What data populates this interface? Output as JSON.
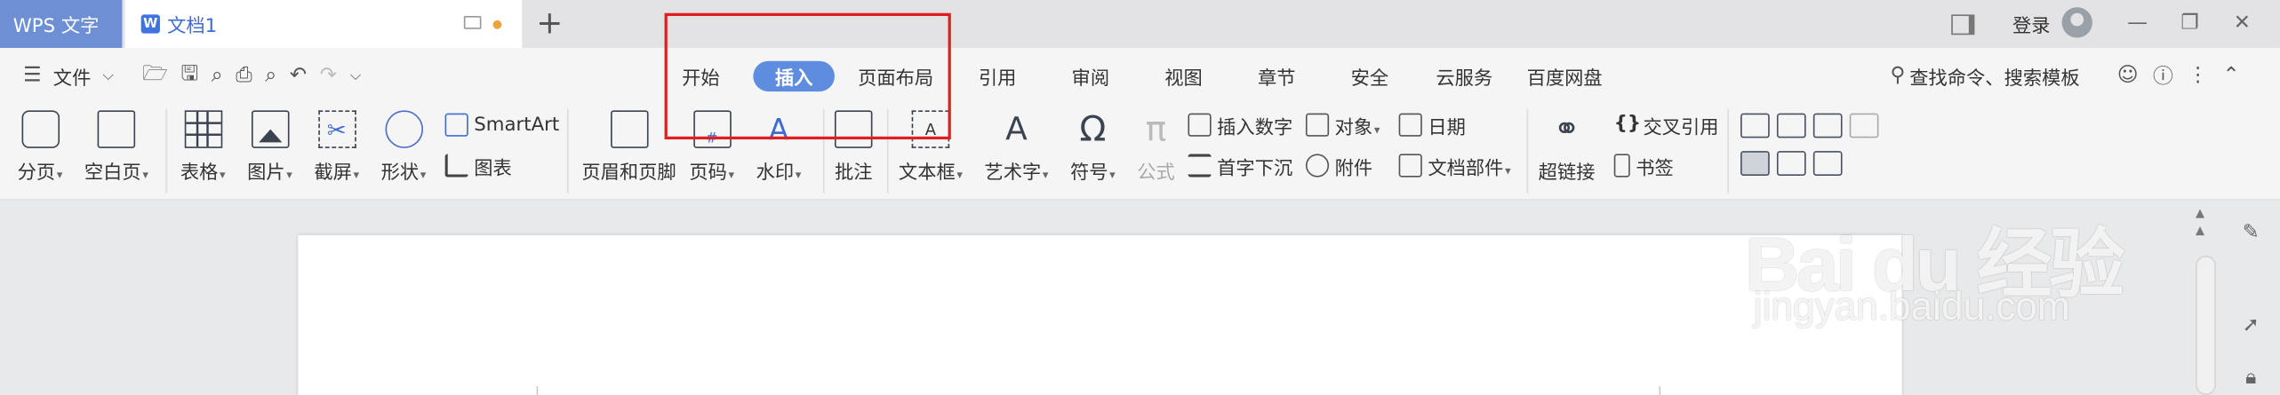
{
  "titlebar": {
    "app_tab": "WPS 文字",
    "doc_tab": "文档1",
    "doc_icon_letter": "W",
    "new_tab": "+",
    "login": "登录"
  },
  "menubar": {
    "file_label": "文件",
    "tabs": [
      {
        "label": "开始",
        "active": false
      },
      {
        "label": "插入",
        "active": true
      },
      {
        "label": "页面布局",
        "active": false
      },
      {
        "label": "引用",
        "active": false
      },
      {
        "label": "审阅",
        "active": false
      },
      {
        "label": "视图",
        "active": false
      },
      {
        "label": "章节",
        "active": false
      },
      {
        "label": "安全",
        "active": false
      },
      {
        "label": "云服务",
        "active": false
      },
      {
        "label": "百度网盘",
        "active": false
      }
    ],
    "search_label": "查找命令、搜索模板"
  },
  "ribbon": {
    "page_break": "分页",
    "blank_page": "空白页",
    "table": "表格",
    "picture": "图片",
    "screenshot": "截屏",
    "shape": "形状",
    "smartart": "SmartArt",
    "chart": "图表",
    "header_footer": "页眉和页脚",
    "page_number": "页码",
    "page_number_glyph": "#",
    "watermark": "水印",
    "comment": "批注",
    "textbox": "文本框",
    "wordart": "艺术字",
    "symbol": "符号",
    "formula": "公式",
    "insert_number": "插入数字",
    "first_drop": "首字下沉",
    "object": "对象",
    "attachment": "附件",
    "date": "日期",
    "doc_parts": "文档部件",
    "hyperlink": "超链接",
    "cross_ref": "交叉引用",
    "bookmark": "书签"
  },
  "watermark": {
    "brand": "Bai du 经验",
    "url": "jingyan.baidu.com"
  },
  "colors": {
    "accent": "#5e8de0",
    "app_tab": "#6d8fd4",
    "highlight": "#e02020"
  }
}
